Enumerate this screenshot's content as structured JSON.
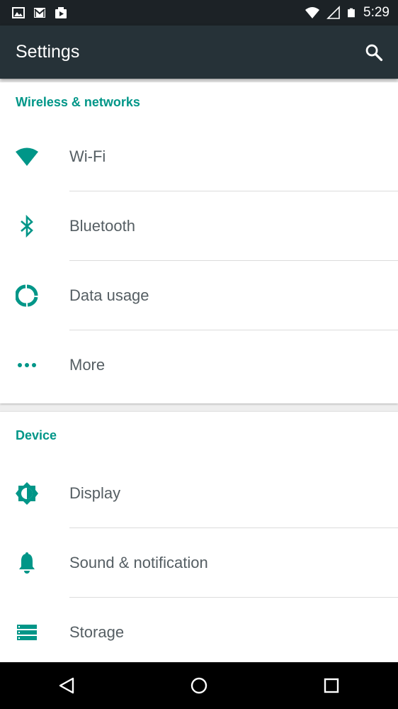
{
  "status_bar": {
    "time": "5:29",
    "left_icons": [
      "image-icon",
      "gmail-icon",
      "media-icon"
    ],
    "right_icons": [
      "wifi-signal-icon",
      "cell-signal-icon",
      "battery-icon"
    ]
  },
  "app_bar": {
    "title": "Settings",
    "search_icon": "search-icon"
  },
  "sections": [
    {
      "header": "Wireless & networks",
      "items": [
        {
          "label": "Wi-Fi",
          "icon": "wifi-icon"
        },
        {
          "label": "Bluetooth",
          "icon": "bluetooth-icon"
        },
        {
          "label": "Data usage",
          "icon": "data-usage-icon"
        },
        {
          "label": "More",
          "icon": "more-dots-icon"
        }
      ]
    },
    {
      "header": "Device",
      "items": [
        {
          "label": "Display",
          "icon": "brightness-icon"
        },
        {
          "label": "Sound & notification",
          "icon": "bell-icon"
        },
        {
          "label": "Storage",
          "icon": "storage-icon"
        }
      ]
    }
  ],
  "nav_bar": {
    "buttons": [
      "back-icon",
      "home-icon",
      "recents-icon"
    ]
  },
  "colors": {
    "accent": "#009688",
    "app_bar": "#263238",
    "status_bar": "#1c2226",
    "text": "#555e63"
  }
}
